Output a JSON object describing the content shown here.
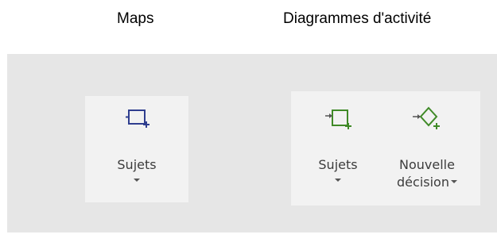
{
  "captions": {
    "maps": "Maps",
    "activity": "Diagrammes d'activité"
  },
  "groups": {
    "maps": {
      "subjects": {
        "label": "Sujets",
        "icon": "topic-rectangle-icon",
        "color": "#2f3e8f"
      }
    },
    "activity": {
      "subjects": {
        "label": "Sujets",
        "icon": "action-rectangle-add-icon",
        "color": "#3f8a27"
      },
      "new_decision": {
        "label_line1": "Nouvelle",
        "label_line2": "décision",
        "icon": "decision-diamond-add-icon",
        "color": "#3f8a27"
      }
    }
  },
  "colors": {
    "ribbon_bg": "#e6e6e6",
    "group_bg": "#f2f2f2",
    "maps_icon": "#2f3e8f",
    "activity_icon": "#3f8a27"
  }
}
